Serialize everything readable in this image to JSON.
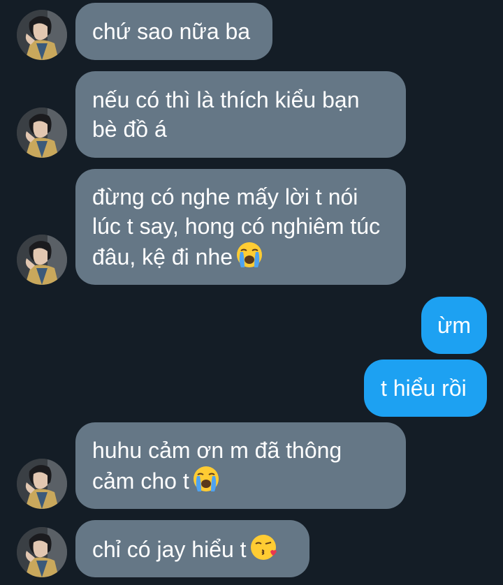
{
  "colors": {
    "background": "#141d26",
    "incoming_bubble": "#657786",
    "outgoing_bubble": "#1da1f2",
    "text": "#ffffff"
  },
  "messages": [
    {
      "side": "incoming",
      "text": "chứ sao nữa ba",
      "has_avatar": true
    },
    {
      "side": "incoming",
      "text": "nếu có thì là thích kiểu bạn bè đồ á",
      "has_avatar": true
    },
    {
      "side": "incoming",
      "text": "đừng có nghe mấy lời t nói lúc t say, hong có nghiêm túc đâu, kệ đi nhe",
      "emoji": "loudly-crying-face",
      "has_avatar": true
    },
    {
      "side": "outgoing",
      "text": "ừm"
    },
    {
      "side": "outgoing",
      "text": "t hiểu rồi"
    },
    {
      "side": "incoming",
      "text": "huhu cảm ơn m đã thông cảm cho t",
      "emoji": "loudly-crying-face",
      "has_avatar": true
    },
    {
      "side": "incoming",
      "text": "chỉ có jay hiểu t",
      "emoji": "face-blowing-a-kiss",
      "has_avatar": true
    }
  ]
}
